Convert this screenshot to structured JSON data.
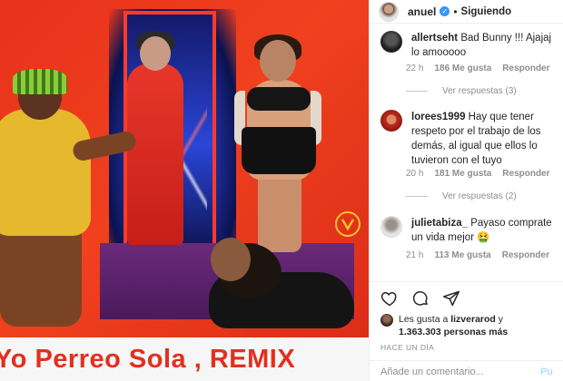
{
  "post": {
    "username": "anuel",
    "verified": true,
    "separator": "•",
    "follow_state": "Siguiendo"
  },
  "media": {
    "caption_overlay": "Yo Perreo Sola , REMIX"
  },
  "comments": [
    {
      "user": "allertseht",
      "text": "Bad Bunny !!! Ajajaj lo amooooo",
      "time": "22 h",
      "likes": "186 Me gusta",
      "reply": "Responder",
      "view_replies": "Ver respuestas (3)"
    },
    {
      "user": "lorees1999",
      "text": "Hay que tener respeto por el trabajo de los demás, al igual que ellos lo tuvieron con el tuyo",
      "time": "20 h",
      "likes": "181 Me gusta",
      "reply": "Responder",
      "view_replies": "Ver respuestas (2)"
    },
    {
      "user": "julietabiza_",
      "text": "Payaso comprate un vida mejor 🤮",
      "time": "21 h",
      "likes": "113 Me gusta",
      "reply": "Responder"
    }
  ],
  "actions": {
    "icons": [
      "heart-icon",
      "comment-icon",
      "share-icon"
    ]
  },
  "likes_summary": {
    "prefix": "Les gusta a",
    "user": "lizverarod",
    "connector": "y",
    "count": "1.363.303",
    "suffix": "personas más"
  },
  "timestamp": "HACE UN DÍA",
  "add_comment": {
    "placeholder": "Añade un comentario...",
    "post_label": "Pu"
  }
}
